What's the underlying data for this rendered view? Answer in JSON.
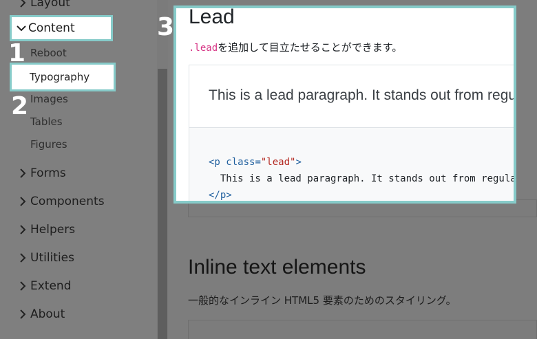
{
  "sidebar": {
    "partial_top": "Layout",
    "content": "Content",
    "sub_items": [
      "Reboot",
      "Typography",
      "Images",
      "Tables",
      "Figures"
    ],
    "items": [
      "Forms",
      "Components",
      "Helpers",
      "Utilities",
      "Extend",
      "About"
    ]
  },
  "steps": [
    "1",
    "2",
    "3"
  ],
  "panel": {
    "title": "Lead",
    "desc_code": ".lead",
    "desc_text": "を追加して目立たせることができます。",
    "example_text": "This is a lead paragraph. It stands out from regular",
    "code": {
      "l1_open": "<p ",
      "l1_attr": "class=",
      "l1_str": "\"lead\"",
      "l1_close": ">",
      "l2": "  This is a lead paragraph. It stands out from regular",
      "l3": "</p>"
    }
  },
  "inline_section": {
    "title": "Inline text elements",
    "desc": "一般的なインライン HTML5 要素のためのスタイリング。"
  },
  "colors": {
    "highlight_border": "#86cbc9",
    "overlay": "#7d7d7d",
    "code_pink": "#d63384"
  }
}
